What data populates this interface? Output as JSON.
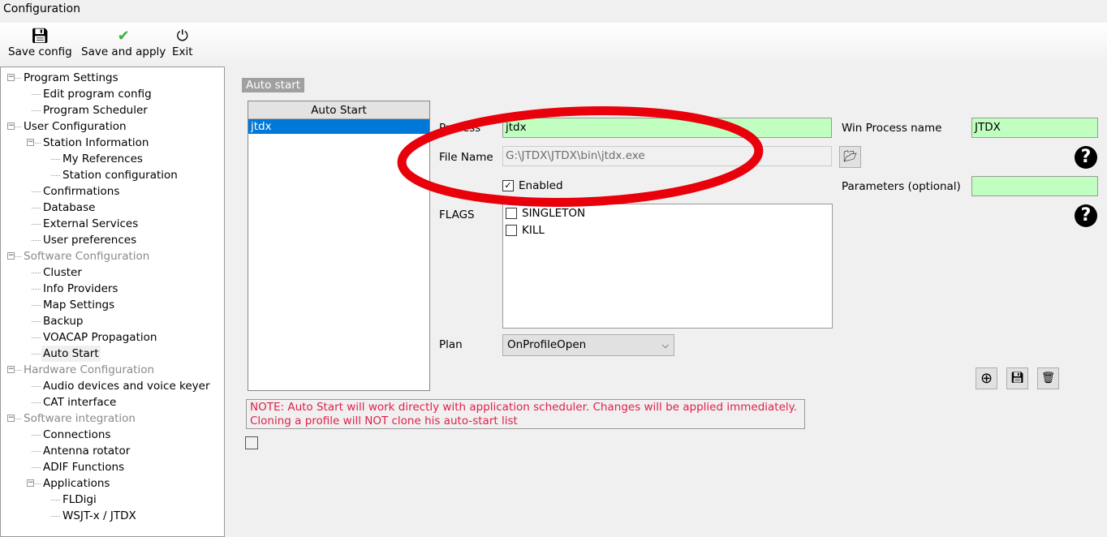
{
  "window": {
    "title": "Configuration"
  },
  "toolbar": {
    "save_config": "Save config",
    "save_apply": "Save and apply",
    "exit": "Exit"
  },
  "tree": [
    {
      "label": "Program Settings",
      "level": 0,
      "expander": "minus"
    },
    {
      "label": "Edit program config",
      "level": 1
    },
    {
      "label": "Program Scheduler",
      "level": 1
    },
    {
      "label": "User Configuration",
      "level": 0,
      "expander": "minus"
    },
    {
      "label": "Station Information",
      "level": 1,
      "expander": "minus"
    },
    {
      "label": "My References",
      "level": 2
    },
    {
      "label": "Station configuration",
      "level": 2
    },
    {
      "label": "Confirmations",
      "level": 1
    },
    {
      "label": "Database",
      "level": 1
    },
    {
      "label": "External Services",
      "level": 1
    },
    {
      "label": "User preferences",
      "level": 1
    },
    {
      "label": "Software Configuration",
      "level": 0,
      "expander": "minus",
      "disabled": true
    },
    {
      "label": "Cluster",
      "level": 1
    },
    {
      "label": "Info Providers",
      "level": 1
    },
    {
      "label": "Map Settings",
      "level": 1
    },
    {
      "label": "Backup",
      "level": 1
    },
    {
      "label": "VOACAP Propagation",
      "level": 1
    },
    {
      "label": "Auto Start",
      "level": 1,
      "selected": true
    },
    {
      "label": "Hardware Configuration",
      "level": 0,
      "expander": "minus",
      "disabled": true
    },
    {
      "label": "Audio devices and voice keyer",
      "level": 1
    },
    {
      "label": "CAT interface",
      "level": 1
    },
    {
      "label": "Software integration",
      "level": 0,
      "expander": "minus",
      "disabled": true
    },
    {
      "label": "Connections",
      "level": 1
    },
    {
      "label": "Antenna rotator",
      "level": 1
    },
    {
      "label": "ADIF Functions",
      "level": 1
    },
    {
      "label": "Applications",
      "level": 1,
      "expander": "minus"
    },
    {
      "label": "FLDigi",
      "level": 2
    },
    {
      "label": "WSJT-x / JTDX",
      "level": 2
    }
  ],
  "panel": {
    "tag": "Auto start",
    "list": {
      "header": "Auto Start",
      "items": [
        "jtdx"
      ],
      "selected": "jtdx"
    },
    "process_label": "Process",
    "process_value": "jtdx",
    "filename_label": "File Name",
    "filename_value": "G:\\JTDX\\JTDX\\bin\\jtdx.exe",
    "enabled_label": "Enabled",
    "enabled": true,
    "flags_label": "FLAGS",
    "flags": [
      {
        "label": "SINGLETON",
        "checked": false
      },
      {
        "label": "KILL",
        "checked": false
      }
    ],
    "plan_label": "Plan",
    "plan_value": "OnProfileOpen",
    "win_process_label": "Win Process name",
    "win_process_value": "JTDX",
    "params_label": "Parameters (optional)",
    "params_value": "",
    "help_glyph": "?",
    "note_line1": "NOTE: Auto Start will work directly with application scheduler. Changes will be applied immediately.",
    "note_line2": "Cloning a profile will NOT clone his auto-start list"
  },
  "annotation_color": "#e8000b"
}
